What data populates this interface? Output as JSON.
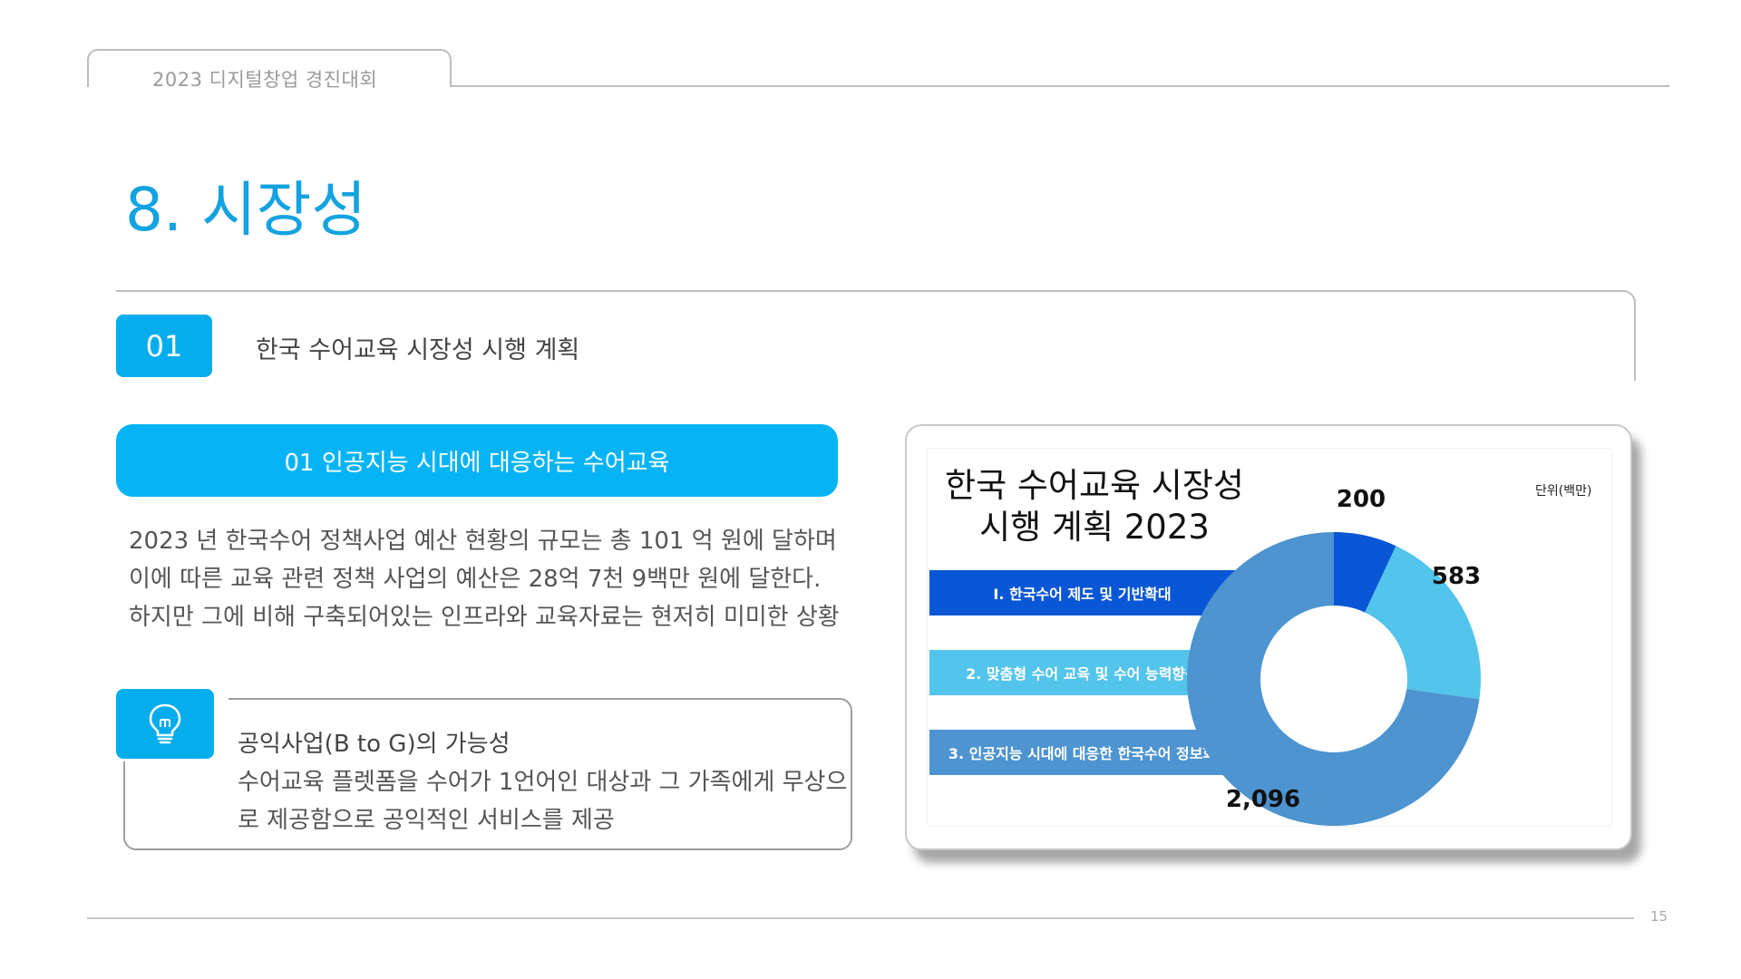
{
  "header": {
    "event_title": "2023 디지털창업 경진대회"
  },
  "page": {
    "title": "8. 시장성",
    "number": "15"
  },
  "section": {
    "number": "01",
    "label": "한국 수어교육 시장성 시행 계획"
  },
  "topic": {
    "label": "01 인공지능 시대에 대응하는 수어교육",
    "body": "2023 년 한국수어 정책사업 예산 현황의 규모는 총 101 억 원에 달하며 이에 따른 교육 관련 정책 사업의 예산은 28억 7천 9백만 원에 달한다. 하지만 그에 비해 구축되어있는 인프라와 교육자료는 현저히 미미한 상황"
  },
  "idea": {
    "icon": "lightbulb-icon",
    "title": "공익사업(B to G)의 가능성",
    "description": "수어교육 플렛폼을 수어가 1언어인 대상과 그 가족에게 무상으로 제공함으로 공익적인 서비스를 제공"
  },
  "colors": {
    "accent": "#06adec",
    "title": "#14a3e0"
  },
  "chart_data": {
    "type": "pie",
    "title_lines": [
      "한국 수어교육 시장성",
      "시행 계획 2023"
    ],
    "unit_label": "단위(백만)",
    "categories": [
      "I. 한국수어 제도 및 기반확대",
      "2. 맞춤형 수어 교육 및 수어 능력향상",
      "3. 인공지능 시대에 대응한 한국수어 정보화"
    ],
    "values": [
      200,
      583,
      2096
    ],
    "value_labels": [
      "200",
      "583",
      "2,096"
    ],
    "colors": [
      "#0957d6",
      "#53c4eb",
      "#4d94d0"
    ]
  }
}
